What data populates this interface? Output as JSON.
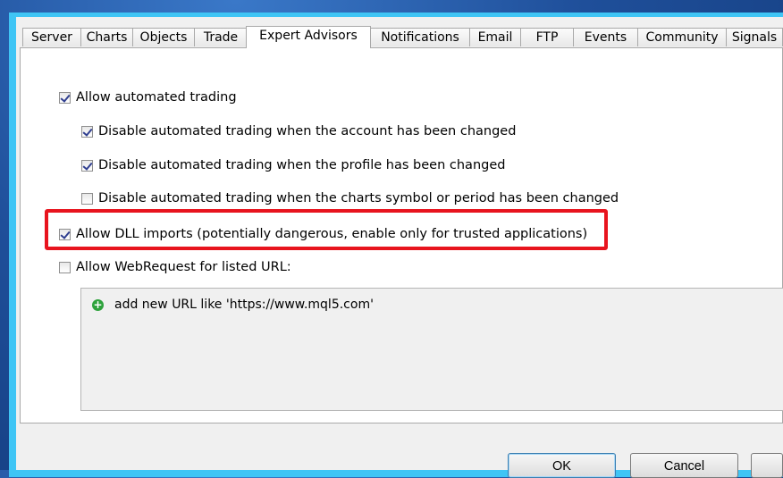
{
  "tabs": [
    "Server",
    "Charts",
    "Objects",
    "Trade",
    "Expert Advisors",
    "Notifications",
    "Email",
    "FTP",
    "Events",
    "Community",
    "Signals"
  ],
  "active_tab": "Expert Advisors",
  "options": {
    "allow_automated": {
      "label": "Allow automated trading",
      "checked": true
    },
    "disable_account": {
      "label": "Disable automated trading when the account has been changed",
      "checked": true
    },
    "disable_profile": {
      "label": "Disable automated trading when the profile has been changed",
      "checked": true
    },
    "disable_symbol": {
      "label": "Disable automated trading when the charts symbol or period has been changed",
      "checked": false
    },
    "allow_dll": {
      "label": "Allow DLL imports (potentially dangerous, enable only for trusted applications)",
      "checked": true
    },
    "allow_webrequest": {
      "label": "Allow WebRequest for listed URL:",
      "checked": false
    }
  },
  "url_list": {
    "add_item": "add new URL like 'https://www.mql5.com'"
  },
  "buttons": {
    "ok": "OK",
    "cancel": "Cancel"
  },
  "colors": {
    "highlight": "#e8141e",
    "frame": "#3fc5f5",
    "add_icon": "#2ea23c"
  }
}
